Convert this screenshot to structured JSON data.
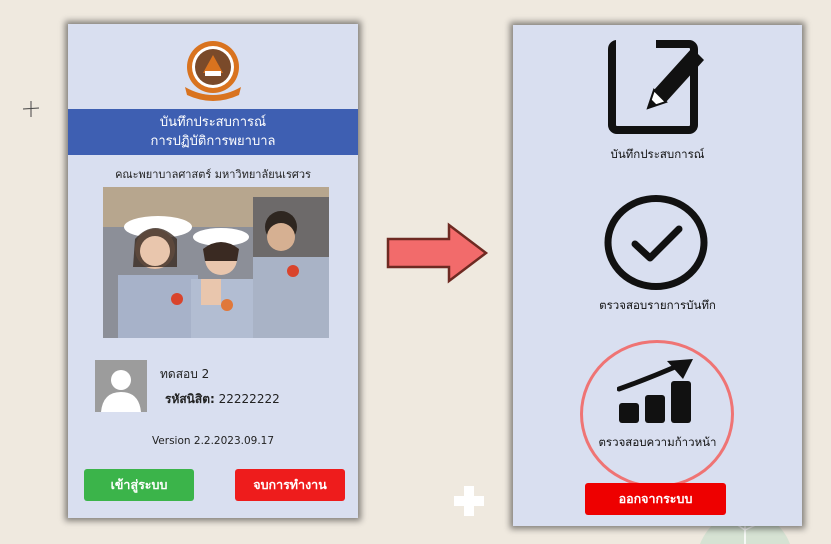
{
  "left_screen": {
    "title_line1": "บันทึกประสบการณ์",
    "title_line2": "การปฏิบัติการพยาบาล",
    "faculty": "คณะพยาบาลศาสตร์ มหาวิทยาลัยนเรศวร",
    "user": {
      "name": "ทดสอบ 2",
      "id_label": "รหัสนิสิต:",
      "id_value": "22222222"
    },
    "version": "Version 2.2.2023.09.17",
    "login_button": "เข้าสู่ระบบ",
    "exit_button": "จบการทำงาน"
  },
  "right_screen": {
    "menu": [
      {
        "label": "บันทึกประสบการณ์",
        "icon": "edit-note-icon"
      },
      {
        "label": "ตรวจสอบรายการบันทึก",
        "icon": "check-circle-icon"
      },
      {
        "label": "ตรวจสอบความก้าวหน้า",
        "icon": "progress-chart-icon"
      }
    ],
    "logout_button": "ออกจากระบบ"
  },
  "colors": {
    "title_band": "#3e5fb2",
    "login_green": "#3bb44a",
    "exit_red": "#ee1c1c",
    "arrow": "#f26b6b",
    "highlight": "#ef7474"
  }
}
